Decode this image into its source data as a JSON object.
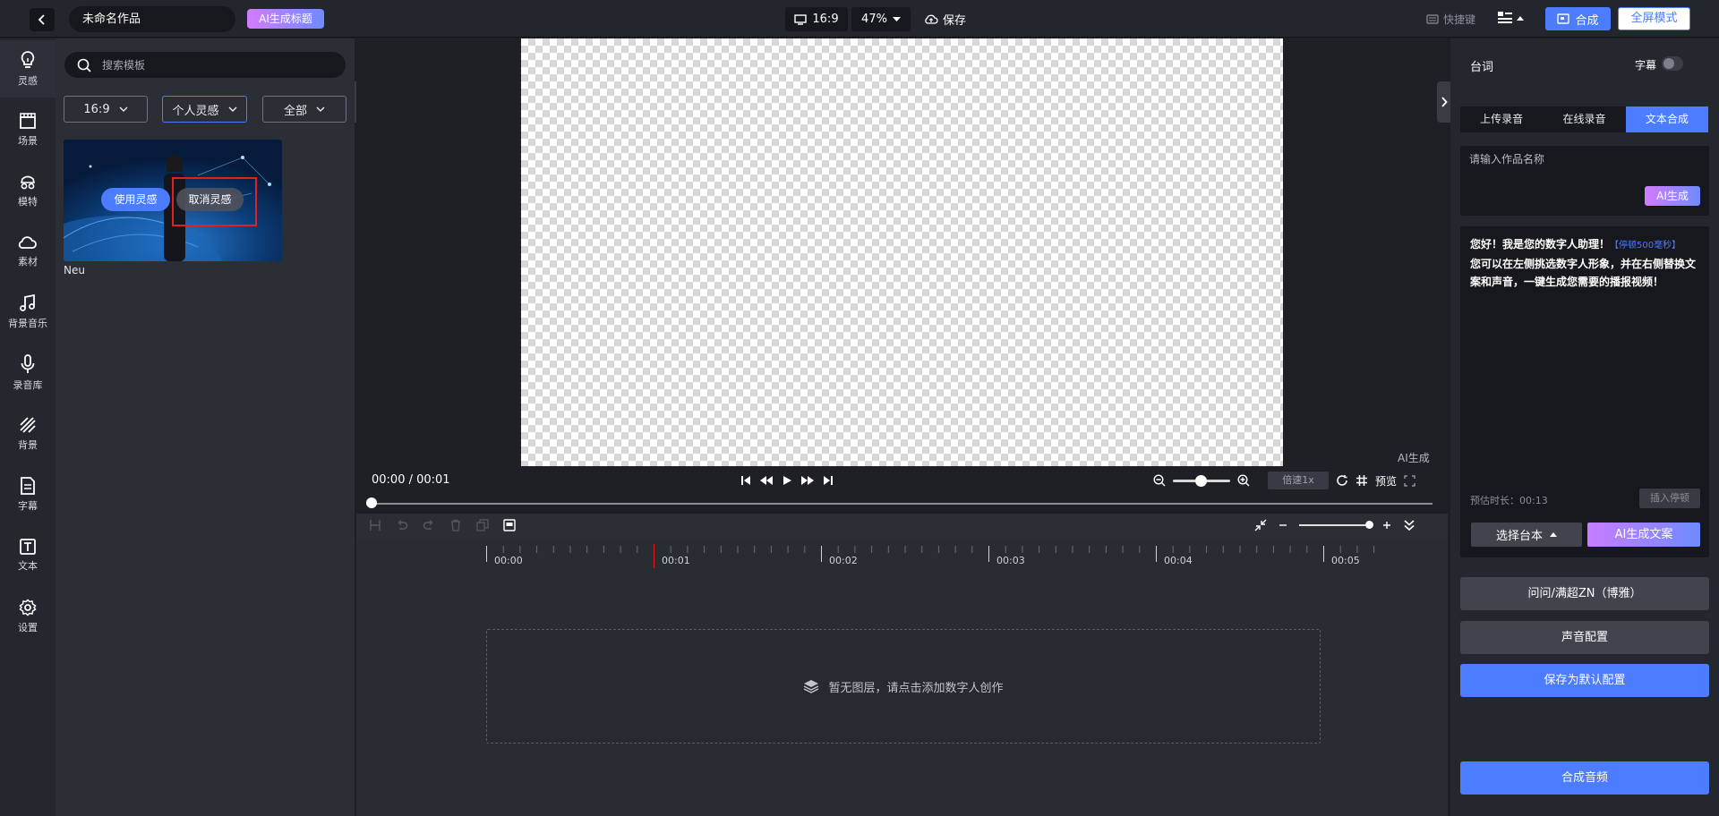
{
  "topbar": {
    "project_title": "未命名作品",
    "ai_title_label": "AI生成标题",
    "aspect_ratio": "16:9",
    "zoom": "47%",
    "save_label": "保存",
    "shortcut_label": "快捷键",
    "compose_label": "合成",
    "fullscreen_label": "全屏模式"
  },
  "sidebar": {
    "items": [
      {
        "label": "灵感"
      },
      {
        "label": "场景"
      },
      {
        "label": "模特"
      },
      {
        "label": "素材"
      },
      {
        "label": "背景音乐"
      },
      {
        "label": "录音库"
      },
      {
        "label": "背景"
      },
      {
        "label": "字幕"
      },
      {
        "label": "文本"
      },
      {
        "label": "设置"
      }
    ]
  },
  "leftpanel": {
    "search_placeholder": "搜索模板",
    "filters": [
      {
        "label": "16:9"
      },
      {
        "label": "个人灵感"
      },
      {
        "label": "全部"
      }
    ],
    "card": {
      "use_label": "使用灵感",
      "cancel_label": "取消灵感",
      "title": "Neu"
    }
  },
  "canvas": {
    "watermark": "AI生成"
  },
  "player": {
    "time": "00:00 / 00:01",
    "speed": "倍速1x",
    "preview_label": "预览",
    "progress": 0
  },
  "timeline": {
    "ruler": [
      "00:00",
      "00:01",
      "00:02",
      "00:03",
      "00:04",
      "00:05"
    ],
    "empty_text": "暂无图层，请点击添加数字人创作"
  },
  "rightpanel": {
    "title": "台词",
    "subtitle_label": "字幕",
    "tabs": [
      {
        "label": "上传录音"
      },
      {
        "label": "在线录音"
      },
      {
        "label": "文本合成"
      }
    ],
    "name_placeholder": "请输入作品名称",
    "ai_gen_label": "AI生成",
    "script_line1": "您好！我是您的数字人助理！",
    "pause_tag": "【停顿500毫秒】",
    "script_line2": "您可以在左侧挑选数字人形象，并在右侧替换文案和声音，一键生成您需要的播报视频！",
    "duration": "预估时长：00:13",
    "insert_pause": "插入停顿",
    "choose_script": "选择台本",
    "ai_copy": "AI生成文案",
    "voice_name": "问问/满超ZN（博雅）",
    "voice_config": "声音配置",
    "save_default": "保存为默认配置",
    "synth_audio": "合成音频"
  },
  "colors": {
    "accent": "#4c7cff",
    "highlight_box": "#e12020",
    "ai_gradient_start": "#d27cff",
    "ai_gradient_end": "#6f8bff"
  }
}
